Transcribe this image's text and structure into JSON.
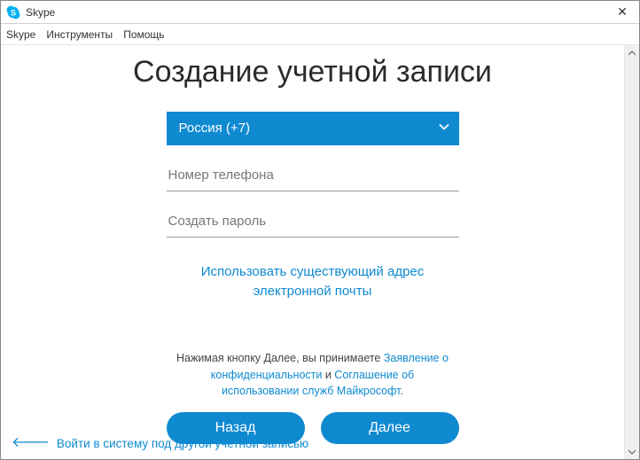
{
  "window": {
    "title": "Skype",
    "close_label": "✕"
  },
  "menubar": {
    "items": [
      "Skype",
      "Инструменты",
      "Помощь"
    ]
  },
  "page": {
    "heading": "Создание учетной записи"
  },
  "form": {
    "country_selected": "Россия (+7)",
    "phone_placeholder": "Номер телефона",
    "password_placeholder": "Создать пароль",
    "use_email_link_line1": "Использовать существующий адрес",
    "use_email_link_line2": "электронной почты"
  },
  "legal": {
    "prefix": "Нажимая кнопку Далее, вы принимаете ",
    "privacy_link": "Заявление о конфиденциальности",
    "and": " и ",
    "terms_link": "Соглашение об использовании служб Майкрософт",
    "suffix": "."
  },
  "buttons": {
    "back": "Назад",
    "next": "Далее"
  },
  "footer": {
    "other_account": "Войти в систему под другой учетной записью"
  }
}
